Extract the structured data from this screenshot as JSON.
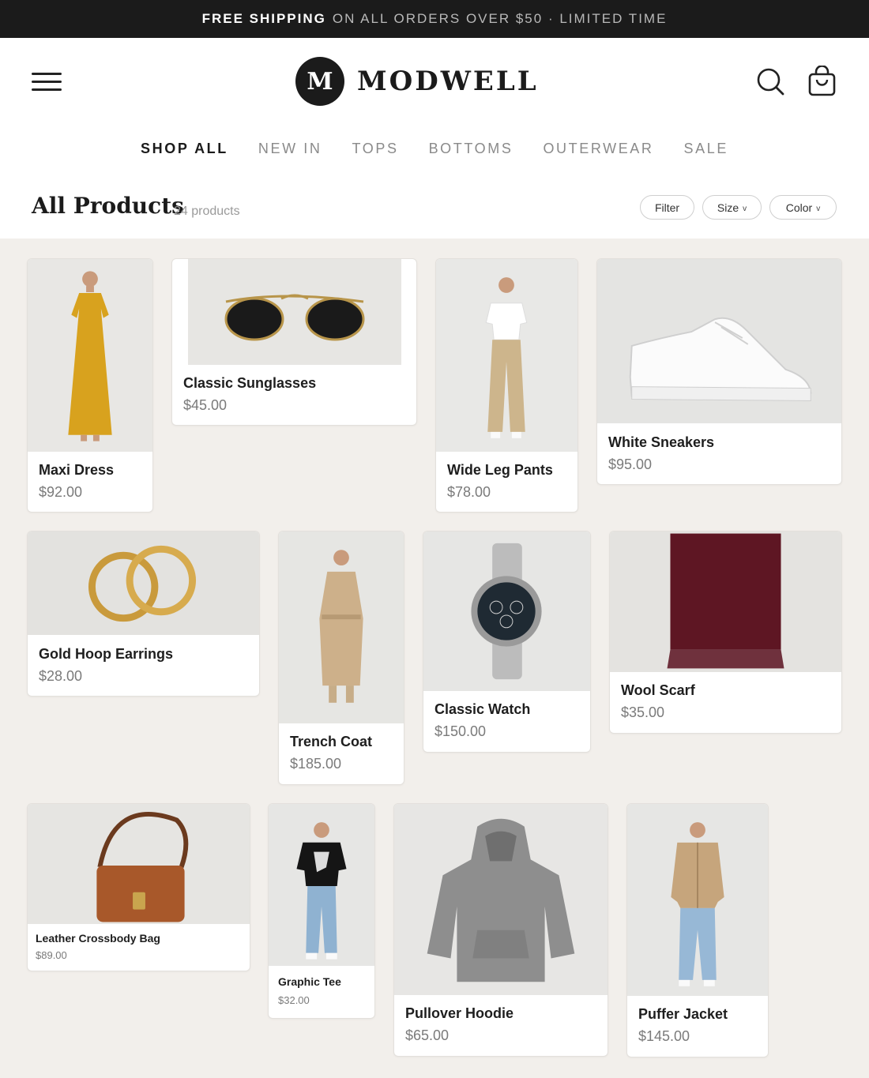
{
  "banner": {
    "strong": "FREE SHIPPING",
    "rest": "ON ALL ORDERS OVER $50 · LIMITED TIME"
  },
  "brand": {
    "mark": "M",
    "name": "MODWELL"
  },
  "nav": [
    "SHOP ALL",
    "NEW IN",
    "TOPS",
    "BOTTOMS",
    "OUTERWEAR",
    "SALE"
  ],
  "page": {
    "title": "All Products",
    "count": "24 products"
  },
  "filters": {
    "filter": "Filter",
    "size": "Size",
    "color": "Color",
    "chevron": "v"
  },
  "products": [
    {
      "name": "Maxi Dress",
      "price": "$92.00",
      "icon": "dress"
    },
    {
      "name": "Classic Sunglasses",
      "price": "$45.00",
      "icon": "sunglasses"
    },
    {
      "name": "Wide Leg Pants",
      "price": "$78.00",
      "icon": "pants"
    },
    {
      "name": "White Sneakers",
      "price": "$95.00",
      "icon": "sneaker"
    },
    {
      "name": "Gold Hoop Earrings",
      "price": "$28.00",
      "icon": "earrings"
    },
    {
      "name": "Trench Coat",
      "price": "$185.00",
      "icon": "coat"
    },
    {
      "name": "Classic Watch",
      "price": "$150.00",
      "icon": "watch"
    },
    {
      "name": "Wool Scarf",
      "price": "$35.00",
      "icon": "scarf"
    },
    {
      "name": "Leather Crossbody Bag",
      "price": "$89.00",
      "icon": "bag"
    },
    {
      "name": "Graphic Tee",
      "price": "$32.00",
      "icon": "tee"
    },
    {
      "name": "Pullover Hoodie",
      "price": "$65.00",
      "icon": "hoodie"
    },
    {
      "name": "Puffer Jacket",
      "price": "$145.00",
      "icon": "jacket"
    }
  ],
  "colors": {
    "banner": "#1b1b1b",
    "page_bg": "#f2efeb",
    "accent": "#1b1b1b",
    "muted": "#8a8a8a"
  }
}
